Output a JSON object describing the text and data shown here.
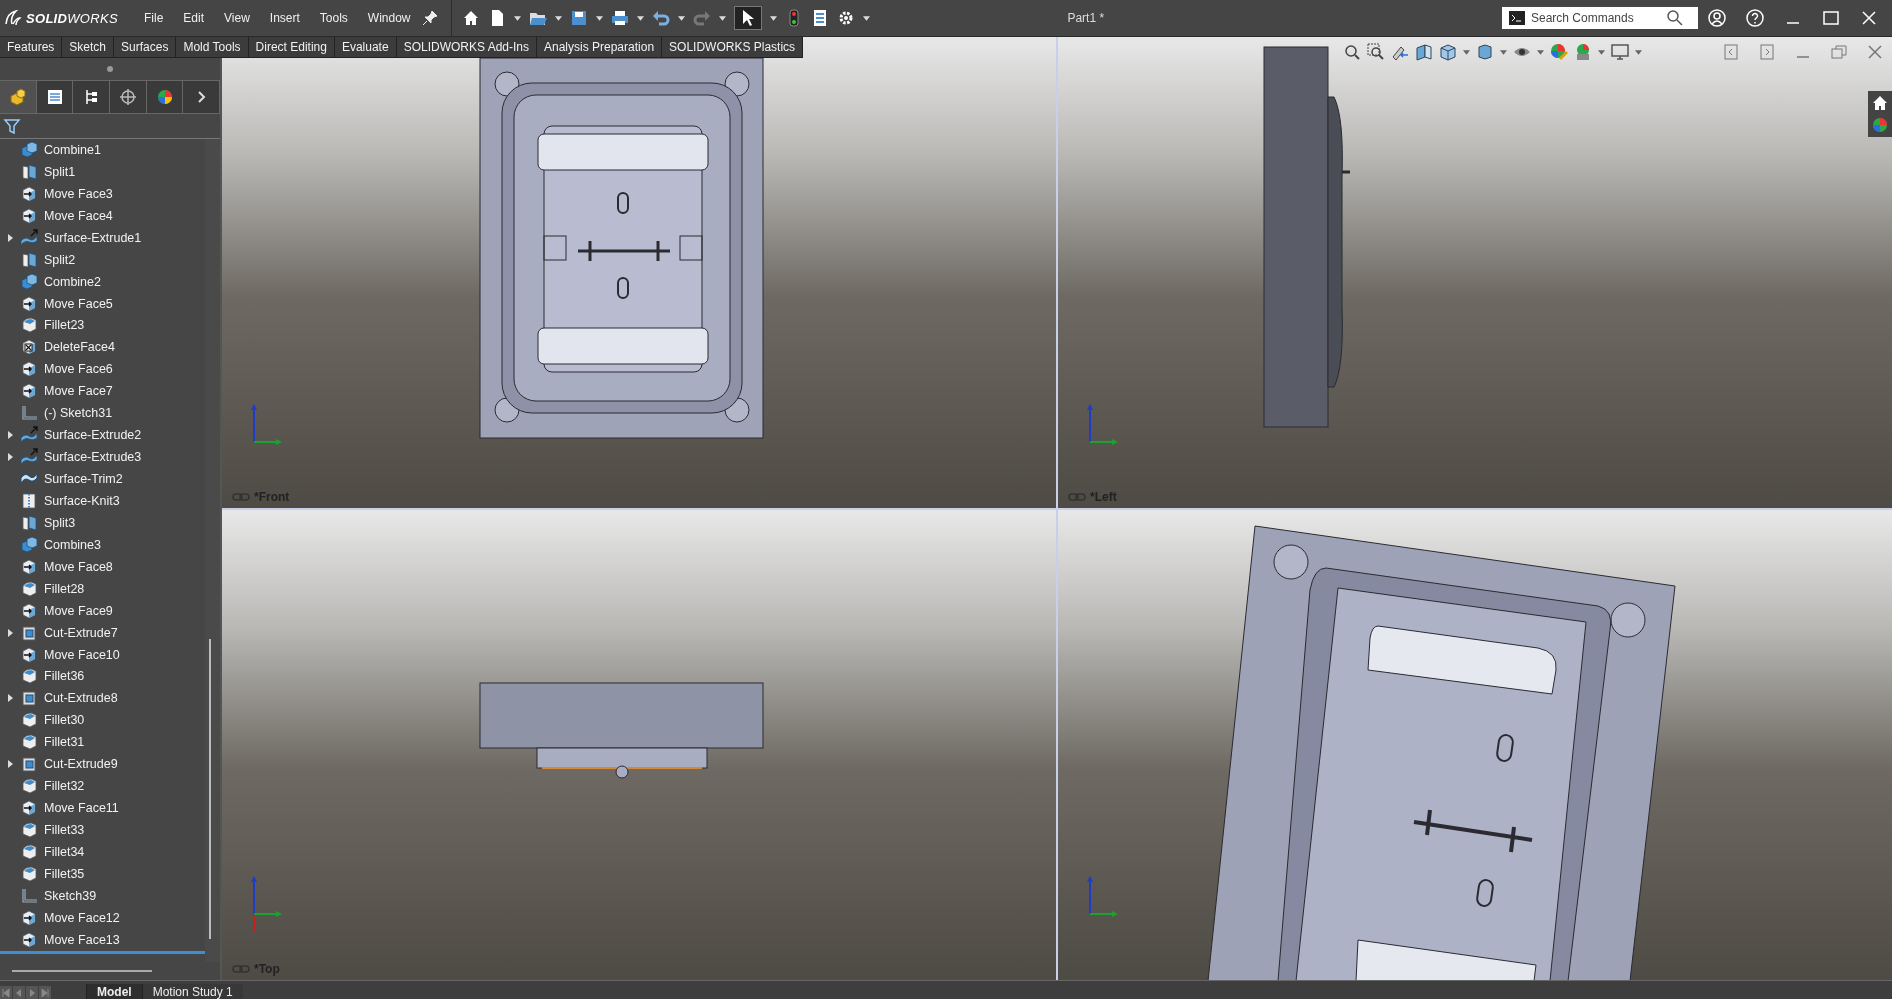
{
  "title_bar": {
    "logo": "**SOLID**WORKS",
    "menus": [
      "File",
      "Edit",
      "View",
      "Insert",
      "Tools",
      "Window"
    ],
    "document_title": "Part1 *",
    "search": {
      "placeholder": "Search Commands"
    }
  },
  "command_tabs": [
    "Features",
    "Sketch",
    "Surfaces",
    "Mold Tools",
    "Direct Editing",
    "Evaluate",
    "SOLIDWORKS Add-Ins",
    "Analysis Preparation",
    "SOLIDWORKS Plastics"
  ],
  "feature_tree": {
    "items": [
      {
        "label": "Combine1",
        "kind": "combine",
        "expandable": false
      },
      {
        "label": "Split1",
        "kind": "split",
        "expandable": false
      },
      {
        "label": "Move Face3",
        "kind": "move-face",
        "expandable": false
      },
      {
        "label": "Move Face4",
        "kind": "move-face",
        "expandable": false
      },
      {
        "label": "Surface-Extrude1",
        "kind": "surface-extrude",
        "expandable": true
      },
      {
        "label": "Split2",
        "kind": "split",
        "expandable": false
      },
      {
        "label": "Combine2",
        "kind": "combine",
        "expandable": false
      },
      {
        "label": "Move Face5",
        "kind": "move-face",
        "expandable": false
      },
      {
        "label": "Fillet23",
        "kind": "fillet",
        "expandable": false
      },
      {
        "label": "DeleteFace4",
        "kind": "delete-face",
        "expandable": false
      },
      {
        "label": "Move Face6",
        "kind": "move-face",
        "expandable": false
      },
      {
        "label": "Move Face7",
        "kind": "move-face",
        "expandable": false
      },
      {
        "label": "(-) Sketch31",
        "kind": "sketch",
        "expandable": false
      },
      {
        "label": "Surface-Extrude2",
        "kind": "surface-extrude",
        "expandable": true
      },
      {
        "label": "Surface-Extrude3",
        "kind": "surface-extrude",
        "expandable": true
      },
      {
        "label": "Surface-Trim2",
        "kind": "surface-trim",
        "expandable": false
      },
      {
        "label": "Surface-Knit3",
        "kind": "surface-knit",
        "expandable": false
      },
      {
        "label": "Split3",
        "kind": "split",
        "expandable": false
      },
      {
        "label": "Combine3",
        "kind": "combine",
        "expandable": false
      },
      {
        "label": "Move Face8",
        "kind": "move-face",
        "expandable": false
      },
      {
        "label": "Fillet28",
        "kind": "fillet",
        "expandable": false
      },
      {
        "label": "Move Face9",
        "kind": "move-face",
        "expandable": false
      },
      {
        "label": "Cut-Extrude7",
        "kind": "cut-extrude",
        "expandable": true
      },
      {
        "label": "Move Face10",
        "kind": "move-face",
        "expandable": false
      },
      {
        "label": "Fillet36",
        "kind": "fillet",
        "expandable": false
      },
      {
        "label": "Cut-Extrude8",
        "kind": "cut-extrude",
        "expandable": true
      },
      {
        "label": "Fillet30",
        "kind": "fillet",
        "expandable": false
      },
      {
        "label": "Fillet31",
        "kind": "fillet",
        "expandable": false
      },
      {
        "label": "Cut-Extrude9",
        "kind": "cut-extrude",
        "expandable": true
      },
      {
        "label": "Fillet32",
        "kind": "fillet",
        "expandable": false
      },
      {
        "label": "Move Face11",
        "kind": "move-face",
        "expandable": false
      },
      {
        "label": "Fillet33",
        "kind": "fillet",
        "expandable": false
      },
      {
        "label": "Fillet34",
        "kind": "fillet",
        "expandable": false
      },
      {
        "label": "Fillet35",
        "kind": "fillet",
        "expandable": false
      },
      {
        "label": "Sketch39",
        "kind": "sketch",
        "expandable": false
      },
      {
        "label": "Move Face12",
        "kind": "move-face",
        "expandable": false
      },
      {
        "label": "Move Face13",
        "kind": "move-face",
        "expandable": false
      }
    ]
  },
  "viewports": [
    {
      "kind": "front",
      "label": "*Front"
    },
    {
      "kind": "left",
      "label": "*Left"
    },
    {
      "kind": "top",
      "label": "*Top"
    },
    {
      "kind": "iso"
    }
  ],
  "bottom_tabs": [
    {
      "label": "Model",
      "selected": true
    },
    {
      "label": "Motion Study 1",
      "selected": false
    }
  ]
}
